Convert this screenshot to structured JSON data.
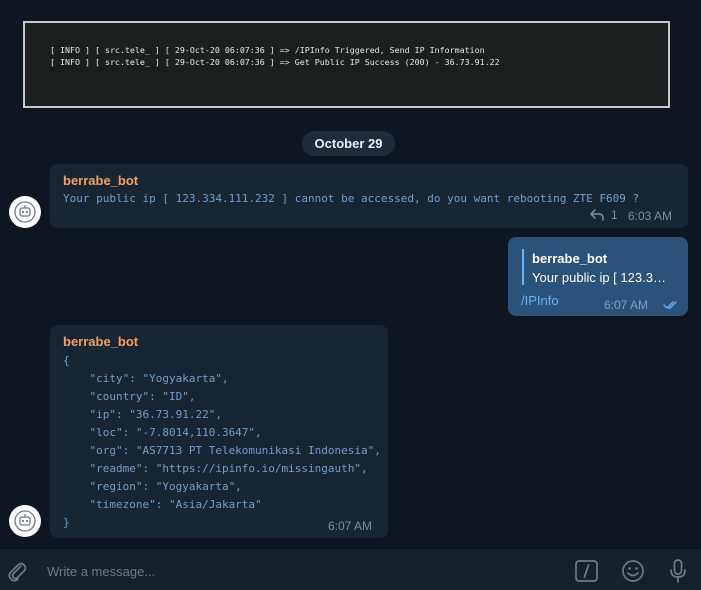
{
  "log": {
    "lines": [
      "[ INFO ] [ src.tele_ ] [ 29-Oct-20 06:07:36 ] => /IPInfo Triggered, Send IP Information",
      "[ INFO ] [ src.tele_ ] [ 29-Oct-20 06:07:36 ] => Get Public IP Success (200) - 36.73.91.22"
    ]
  },
  "date_separator": "October 29",
  "messages": [
    {
      "sender": "berrabe_bot",
      "text": "Your public ip [ 123.334.111.232 ] cannot be accessed, do you want rebooting ZTE F609 ?",
      "reply_count": "1",
      "time": "6:03 AM"
    },
    {
      "reply_to": {
        "name": "berrabe_bot",
        "text": "Your public ip [ 123.3…"
      },
      "text": "/IPInfo",
      "time": "6:07 AM"
    },
    {
      "sender": "berrabe_bot",
      "lines": [
        "{",
        "    \"city\": \"Yogyakarta\",",
        "    \"country\": \"ID\",",
        "    \"ip\": \"36.73.91.22\",",
        "    \"loc\": \"-7.8014,110.3647\",",
        "    \"org\": \"AS7713 PT Telekomunikasi Indonesia\",",
        "    \"readme\": \"https://ipinfo.io/missingauth\",",
        "    \"region\": \"Yogyakarta\",",
        "    \"timezone\": \"Asia/Jakarta\"",
        "}"
      ],
      "time": "6:07 AM"
    }
  ],
  "composer": {
    "placeholder": "Write a message..."
  },
  "icons": {
    "attach": "paperclip-icon",
    "commands": "slash-command-icon",
    "emoji": "emoji-icon",
    "voice": "microphone-icon",
    "read": "double-check-icon",
    "reply": "reply-arrow-icon",
    "avatar": "robot-icon"
  },
  "colors": {
    "background": "#0e1621",
    "incoming_bubble": "#182533",
    "outgoing_bubble": "#2b5278",
    "sender_name": "#f0a060",
    "accent": "#6ab2f2"
  }
}
